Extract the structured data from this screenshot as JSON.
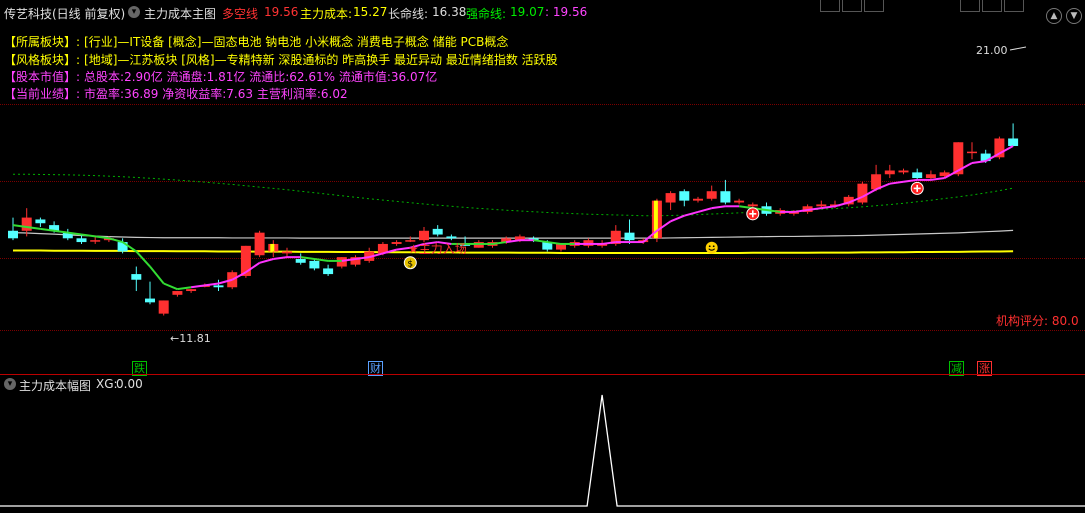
{
  "topbar": {
    "stock_title": "传艺科技(日线 前复权)",
    "indicator_name": "主力成本主图",
    "duokong_label": "多空线",
    "duokong_value": "19.56",
    "zhuli_label": "主力成本:",
    "zhuli_value": "15.27",
    "changming_label": "长命线:",
    "changming_value": "16.38",
    "qiangming_label": "强命线:",
    "qiangming_value": "19.07",
    "extra_value": ": 19.56"
  },
  "info": {
    "sector": {
      "label": "【所属板块】:",
      "value": "[行业]—IT设备 [概念]—固态电池 钠电池 小米概念 消费电子概念 储能 PCB概念"
    },
    "style": {
      "label": "【风格板块】:",
      "value": "[地域]—江苏板块 [风格]—专精特新 深股通标的 昨高换手 最近异动 最近情绪指数 活跃股"
    },
    "cap": {
      "label": "【股本市值】:",
      "value": "总股本:2.90亿 流通盘:1.81亿 流通比:62.61% 流通市值:36.07亿"
    },
    "perf": {
      "label": "【当前业绩】:",
      "value": "市盈率:36.89 净资收益率:7.63 主营利润率:6.02"
    }
  },
  "annotations": {
    "low_price": "←11.81",
    "high_price": "21.00",
    "main_entry": "★主力入场",
    "rating": "机构评分: 80.0"
  },
  "events": [
    {
      "label": "跌",
      "color": "#00c000"
    },
    {
      "label": "财",
      "color": "#5aa0ff"
    },
    {
      "label": "减",
      "color": "#00c000"
    },
    {
      "label": "涨",
      "color": "#ff3030"
    }
  ],
  "subpanel": {
    "title": "主力成本幅图",
    "xg_label": "XG:",
    "xg_value": "0.00"
  },
  "colors": {
    "up": "#ff3030",
    "down": "#54ffff",
    "yellow_line": "#ffff00",
    "white_line": "#c8c8c8",
    "green_dotted": "#00b000",
    "trend_up": "#ff33ff",
    "trend_down": "#33dd33"
  },
  "icons": [
    "chevron-down-icon",
    "dollar-badge-icon",
    "smiley-icon",
    "plus-badge-icon"
  ],
  "price_range": [
    10.5,
    22.5
  ],
  "candles": [
    {
      "o": 16.3,
      "h": 17.0,
      "l": 15.8,
      "c": 15.9
    },
    {
      "o": 16.3,
      "h": 17.5,
      "l": 16.0,
      "c": 17.0
    },
    {
      "o": 16.9,
      "h": 17.0,
      "l": 16.5,
      "c": 16.7
    },
    {
      "o": 16.6,
      "h": 16.8,
      "l": 16.2,
      "c": 16.3
    },
    {
      "o": 16.2,
      "h": 16.4,
      "l": 15.8,
      "c": 15.9
    },
    {
      "o": 15.9,
      "h": 16.1,
      "l": 15.6,
      "c": 15.7
    },
    {
      "o": 15.8,
      "h": 16.0,
      "l": 15.6,
      "c": 15.8
    },
    {
      "o": 15.8,
      "h": 16.0,
      "l": 15.7,
      "c": 15.9
    },
    {
      "o": 15.7,
      "h": 15.9,
      "l": 15.1,
      "c": 15.2
    },
    {
      "o": 14.0,
      "h": 14.4,
      "l": 13.1,
      "c": 13.7
    },
    {
      "o": 12.7,
      "h": 13.6,
      "l": 12.4,
      "c": 12.5
    },
    {
      "o": 11.9,
      "h": 12.6,
      "l": 11.8,
      "c": 12.6
    },
    {
      "o": 12.9,
      "h": 13.1,
      "l": 12.8,
      "c": 13.1
    },
    {
      "o": 13.1,
      "h": 13.2,
      "l": 13.0,
      "c": 13.2
    },
    {
      "o": 13.4,
      "h": 13.5,
      "l": 13.3,
      "c": 13.4
    },
    {
      "o": 13.4,
      "h": 13.7,
      "l": 13.1,
      "c": 13.3
    },
    {
      "o": 13.3,
      "h": 14.2,
      "l": 13.2,
      "c": 14.1
    },
    {
      "o": 13.9,
      "h": 15.5,
      "l": 13.8,
      "c": 15.5
    },
    {
      "o": 15.0,
      "h": 16.3,
      "l": 14.9,
      "c": 16.2
    },
    {
      "o": 15.2,
      "h": 15.8,
      "l": 14.9,
      "c": 15.6
    },
    {
      "o": 15.1,
      "h": 15.4,
      "l": 14.9,
      "c": 15.2
    },
    {
      "o": 14.8,
      "h": 15.1,
      "l": 14.5,
      "c": 14.6
    },
    {
      "o": 14.7,
      "h": 14.8,
      "l": 14.2,
      "c": 14.3
    },
    {
      "o": 14.3,
      "h": 14.5,
      "l": 13.9,
      "c": 14.0
    },
    {
      "o": 14.4,
      "h": 14.9,
      "l": 14.3,
      "c": 14.9
    },
    {
      "o": 14.5,
      "h": 15.0,
      "l": 14.4,
      "c": 14.9
    },
    {
      "o": 14.7,
      "h": 15.4,
      "l": 14.6,
      "c": 15.2
    },
    {
      "o": 15.1,
      "h": 15.7,
      "l": 15.0,
      "c": 15.6
    },
    {
      "o": 15.6,
      "h": 15.8,
      "l": 15.5,
      "c": 15.7
    },
    {
      "o": 15.8,
      "h": 16.0,
      "l": 15.7,
      "c": 15.8
    },
    {
      "o": 15.8,
      "h": 16.5,
      "l": 15.7,
      "c": 16.3
    },
    {
      "o": 16.4,
      "h": 16.6,
      "l": 16.0,
      "c": 16.1
    },
    {
      "o": 16.0,
      "h": 16.1,
      "l": 15.8,
      "c": 15.9
    },
    {
      "o": 15.6,
      "h": 16.0,
      "l": 15.5,
      "c": 15.5
    },
    {
      "o": 15.4,
      "h": 15.8,
      "l": 15.4,
      "c": 15.7
    },
    {
      "o": 15.5,
      "h": 15.8,
      "l": 15.4,
      "c": 15.7
    },
    {
      "o": 15.7,
      "h": 16.0,
      "l": 15.6,
      "c": 15.9
    },
    {
      "o": 15.8,
      "h": 16.1,
      "l": 15.7,
      "c": 16.0
    },
    {
      "o": 15.9,
      "h": 16.0,
      "l": 15.7,
      "c": 15.8
    },
    {
      "o": 15.7,
      "h": 15.8,
      "l": 15.2,
      "c": 15.3
    },
    {
      "o": 15.3,
      "h": 15.6,
      "l": 15.2,
      "c": 15.6
    },
    {
      "o": 15.5,
      "h": 15.8,
      "l": 15.4,
      "c": 15.7
    },
    {
      "o": 15.5,
      "h": 15.9,
      "l": 15.4,
      "c": 15.8
    },
    {
      "o": 15.5,
      "h": 15.8,
      "l": 15.4,
      "c": 15.6
    },
    {
      "o": 15.6,
      "h": 16.6,
      "l": 15.5,
      "c": 16.3
    },
    {
      "o": 16.2,
      "h": 16.9,
      "l": 15.6,
      "c": 15.8
    },
    {
      "o": 15.7,
      "h": 15.9,
      "l": 15.6,
      "c": 15.8
    },
    {
      "o": 15.9,
      "h": 18.0,
      "l": 15.7,
      "c": 17.9
    },
    {
      "o": 17.8,
      "h": 18.4,
      "l": 17.4,
      "c": 18.3
    },
    {
      "o": 18.4,
      "h": 18.5,
      "l": 17.6,
      "c": 17.9
    },
    {
      "o": 17.9,
      "h": 18.1,
      "l": 17.8,
      "c": 18.0
    },
    {
      "o": 18.0,
      "h": 18.7,
      "l": 17.9,
      "c": 18.4
    },
    {
      "o": 18.4,
      "h": 19.0,
      "l": 17.7,
      "c": 17.8
    },
    {
      "o": 17.8,
      "h": 18.0,
      "l": 17.7,
      "c": 17.9
    },
    {
      "o": 17.6,
      "h": 17.8,
      "l": 17.4,
      "c": 17.7
    },
    {
      "o": 17.6,
      "h": 17.8,
      "l": 17.1,
      "c": 17.2
    },
    {
      "o": 17.2,
      "h": 17.5,
      "l": 17.1,
      "c": 17.4
    },
    {
      "o": 17.2,
      "h": 17.4,
      "l": 17.1,
      "c": 17.3
    },
    {
      "o": 17.3,
      "h": 17.7,
      "l": 17.2,
      "c": 17.6
    },
    {
      "o": 17.6,
      "h": 17.9,
      "l": 17.5,
      "c": 17.7
    },
    {
      "o": 17.6,
      "h": 17.9,
      "l": 17.5,
      "c": 17.7
    },
    {
      "o": 17.7,
      "h": 18.2,
      "l": 17.6,
      "c": 18.1
    },
    {
      "o": 17.8,
      "h": 18.9,
      "l": 17.7,
      "c": 18.8
    },
    {
      "o": 18.5,
      "h": 19.8,
      "l": 18.4,
      "c": 19.3
    },
    {
      "o": 19.3,
      "h": 19.8,
      "l": 19.1,
      "c": 19.5
    },
    {
      "o": 19.4,
      "h": 19.6,
      "l": 19.3,
      "c": 19.5
    },
    {
      "o": 19.4,
      "h": 19.6,
      "l": 19.0,
      "c": 19.1
    },
    {
      "o": 19.1,
      "h": 19.5,
      "l": 19.0,
      "c": 19.3
    },
    {
      "o": 19.2,
      "h": 19.5,
      "l": 19.1,
      "c": 19.4
    },
    {
      "o": 19.3,
      "h": 21.0,
      "l": 19.2,
      "c": 21.0
    },
    {
      "o": 20.5,
      "h": 21.0,
      "l": 20.1,
      "c": 20.5
    },
    {
      "o": 20.4,
      "h": 20.6,
      "l": 19.9,
      "c": 20.0
    },
    {
      "o": 20.2,
      "h": 21.3,
      "l": 20.1,
      "c": 21.2
    },
    {
      "o": 21.2,
      "h": 22.0,
      "l": 21.0,
      "c": 20.8
    }
  ],
  "series": {
    "trend": [
      16.6,
      16.5,
      16.4,
      16.3,
      16.2,
      16.1,
      16.0,
      15.9,
      15.7,
      15.2,
      14.4,
      13.5,
      13.2,
      13.3,
      13.4,
      13.5,
      13.7,
      14.1,
      14.6,
      14.8,
      14.9,
      14.9,
      14.8,
      14.7,
      14.7,
      14.8,
      14.9,
      15.1,
      15.3,
      15.4,
      15.6,
      15.7,
      15.6,
      15.6,
      15.6,
      15.6,
      15.7,
      15.8,
      15.8,
      15.7,
      15.6,
      15.6,
      15.6,
      15.6,
      15.7,
      15.7,
      15.7,
      16.3,
      16.8,
      17.1,
      17.3,
      17.5,
      17.6,
      17.6,
      17.5,
      17.4,
      17.3,
      17.3,
      17.4,
      17.5,
      17.6,
      17.8,
      18.1,
      18.5,
      18.8,
      18.9,
      19.0,
      19.0,
      19.1,
      19.5,
      19.9,
      20.0,
      20.4,
      20.8
    ],
    "trend_up_flags": [
      0,
      0,
      0,
      0,
      0,
      0,
      0,
      0,
      0,
      0,
      0,
      0,
      0,
      1,
      1,
      1,
      1,
      1,
      1,
      1,
      1,
      0,
      0,
      0,
      1,
      1,
      1,
      1,
      1,
      1,
      1,
      1,
      0,
      0,
      0,
      0,
      1,
      1,
      0,
      0,
      0,
      1,
      1,
      1,
      1,
      1,
      1,
      1,
      1,
      1,
      1,
      1,
      1,
      0,
      0,
      0,
      1,
      1,
      1,
      1,
      1,
      1,
      1,
      1,
      1,
      1,
      1,
      1,
      1,
      1,
      1,
      1,
      1,
      1
    ],
    "white": [
      16.2,
      16.18,
      16.15,
      16.12,
      16.08,
      16.05,
      16.02,
      15.99,
      15.97,
      15.95,
      15.94,
      15.93,
      15.93,
      15.93,
      15.93,
      15.93,
      15.92,
      15.92,
      15.92,
      15.92,
      15.92,
      15.91,
      15.91,
      15.91,
      15.91,
      15.91,
      15.91,
      15.91,
      15.91,
      15.91,
      15.91,
      15.91,
      15.91,
      15.91,
      15.91,
      15.91,
      15.91,
      15.91,
      15.91,
      15.91,
      15.91,
      15.91,
      15.91,
      15.91,
      15.91,
      15.91,
      15.91,
      15.91,
      15.92,
      15.93,
      15.94,
      15.95,
      15.96,
      15.97,
      15.98,
      15.99,
      16.0,
      16.0,
      16.01,
      16.02,
      16.03,
      16.04,
      16.05,
      16.07,
      16.09,
      16.11,
      16.13,
      16.15,
      16.17,
      16.19,
      16.22,
      16.25,
      16.28,
      16.32
    ],
    "yellow": [
      15.25,
      15.25,
      15.25,
      15.24,
      15.24,
      15.24,
      15.23,
      15.23,
      15.23,
      15.22,
      15.22,
      15.22,
      15.21,
      15.21,
      15.21,
      15.2,
      15.2,
      15.2,
      15.19,
      15.19,
      15.19,
      15.18,
      15.18,
      15.18,
      15.17,
      15.17,
      15.17,
      15.16,
      15.16,
      15.16,
      15.15,
      15.15,
      15.15,
      15.14,
      15.14,
      15.14,
      15.14,
      15.13,
      15.13,
      15.13,
      15.12,
      15.12,
      15.12,
      15.12,
      15.12,
      15.12,
      15.12,
      15.12,
      15.12,
      15.12,
      15.12,
      15.12,
      15.12,
      15.12,
      15.13,
      15.13,
      15.13,
      15.13,
      15.13,
      15.14,
      15.14,
      15.14,
      15.15,
      15.15,
      15.16,
      15.16,
      15.17,
      15.17,
      15.18,
      15.18,
      15.19,
      15.2,
      15.2,
      15.21
    ],
    "green_dotted": [
      19.3,
      19.3,
      19.29,
      19.28,
      19.27,
      19.25,
      19.23,
      19.2,
      19.17,
      19.13,
      19.09,
      19.04,
      18.99,
      18.94,
      18.88,
      18.82,
      18.76,
      18.69,
      18.62,
      18.55,
      18.48,
      18.4,
      18.32,
      18.24,
      18.16,
      18.08,
      18.0,
      17.93,
      17.86,
      17.79,
      17.72,
      17.66,
      17.6,
      17.54,
      17.49,
      17.44,
      17.39,
      17.35,
      17.31,
      17.27,
      17.24,
      17.21,
      17.18,
      17.16,
      17.14,
      17.12,
      17.1,
      17.1,
      17.11,
      17.13,
      17.16,
      17.19,
      17.22,
      17.25,
      17.28,
      17.3,
      17.33,
      17.36,
      17.4,
      17.44,
      17.48,
      17.52,
      17.57,
      17.63,
      17.69,
      17.76,
      17.84,
      17.92,
      18.01,
      18.1,
      18.2,
      18.31,
      18.43,
      18.56
    ],
    "sub_peak_index": 43
  }
}
